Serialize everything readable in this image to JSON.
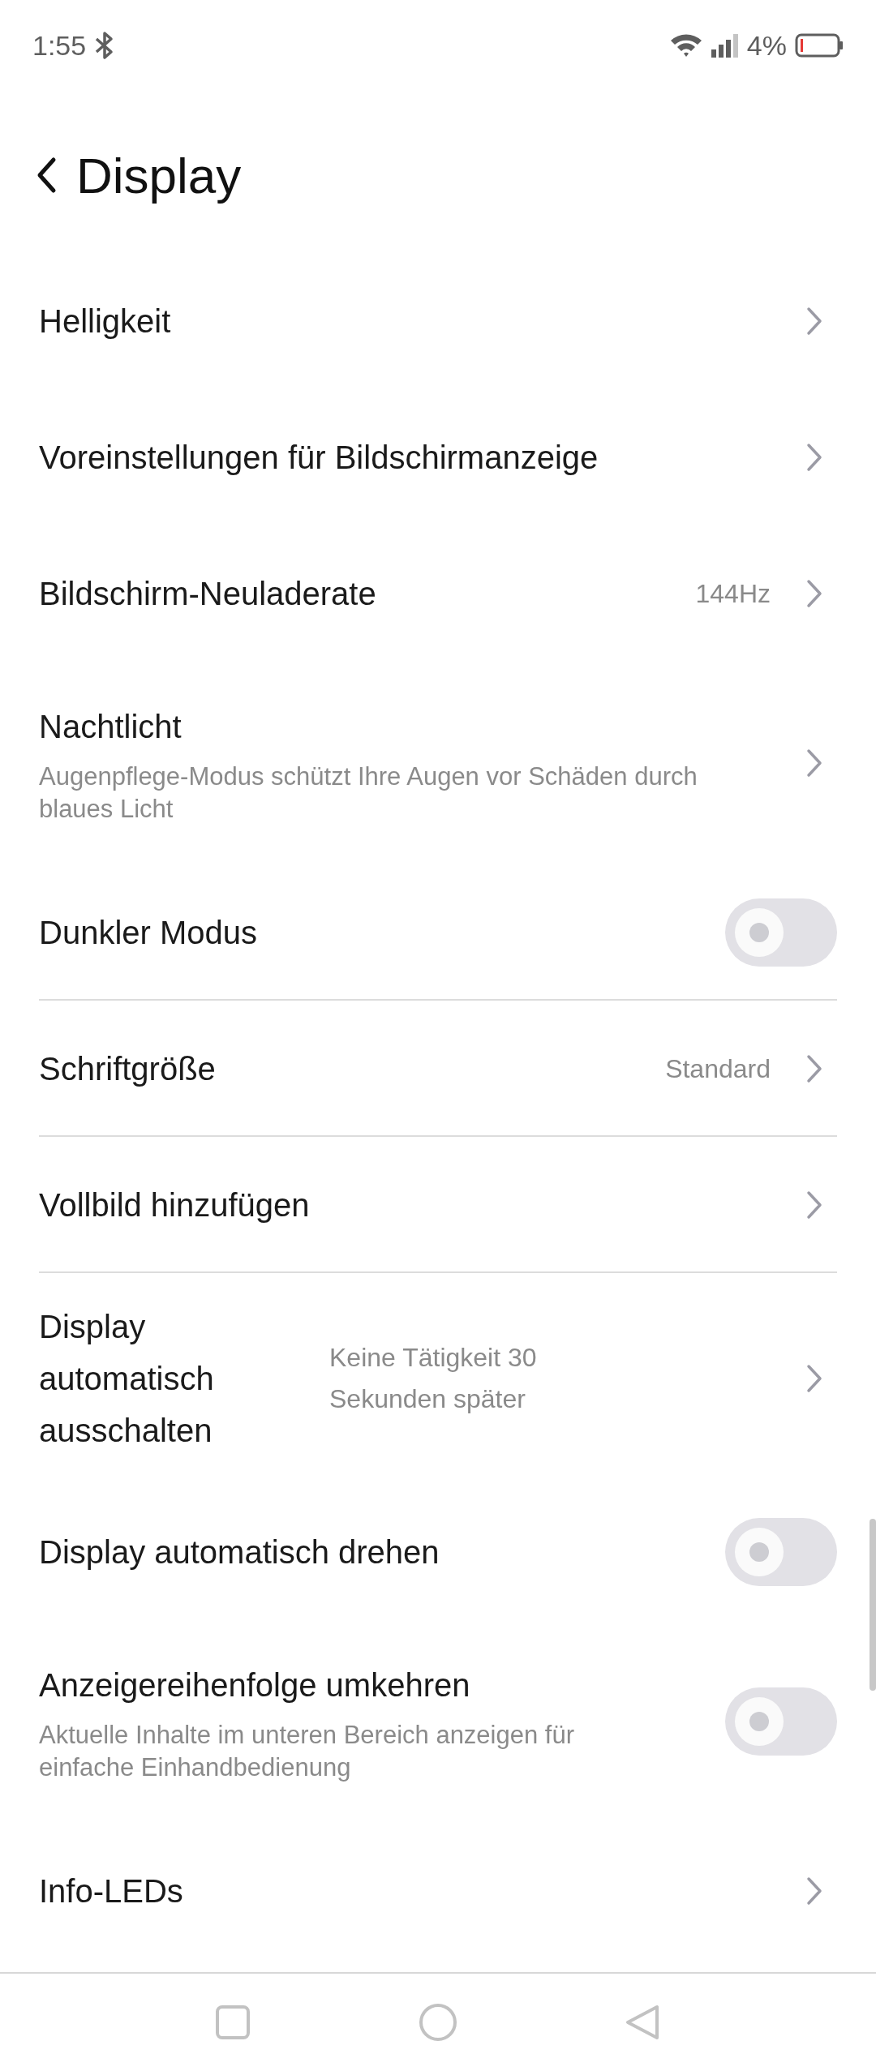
{
  "status_bar": {
    "time": "1:55",
    "battery": "4%"
  },
  "header": {
    "title": "Display"
  },
  "rows": [
    {
      "kind": "link",
      "label": "Helligkeit",
      "divider": false
    },
    {
      "kind": "link",
      "label": "Voreinstellungen für Bildschirmanzeige",
      "divider": false
    },
    {
      "kind": "link",
      "label": "Bildschirm-Neuladerate",
      "value": "144Hz",
      "divider": false
    },
    {
      "kind": "link",
      "label": "Nachtlicht",
      "subtitle": "Augenpflege-Modus schützt Ihre Augen vor Schäden durch blaues Licht",
      "divider": false
    },
    {
      "kind": "toggle",
      "label": "Dunkler Modus",
      "on": false,
      "divider": true
    },
    {
      "kind": "link",
      "label": "Schriftgröße",
      "value": "Standard",
      "divider": true
    },
    {
      "kind": "link",
      "label": "Vollbild hinzufügen",
      "divider": true
    },
    {
      "kind": "link",
      "label": "Display automatisch ausschalten",
      "value": "Keine Tätigkeit 30 Sekunden später",
      "divider": false
    },
    {
      "kind": "toggle",
      "label": "Display automatisch drehen",
      "on": false,
      "divider": false
    },
    {
      "kind": "toggle",
      "label": "Anzeigereihenfolge umkehren",
      "subtitle": "Aktuelle Inhalte im unteren Bereich anzeigen für einfache Einhandbedienung",
      "on": false,
      "divider": false
    },
    {
      "kind": "link",
      "label": "Info-LEDs",
      "divider": false
    }
  ]
}
